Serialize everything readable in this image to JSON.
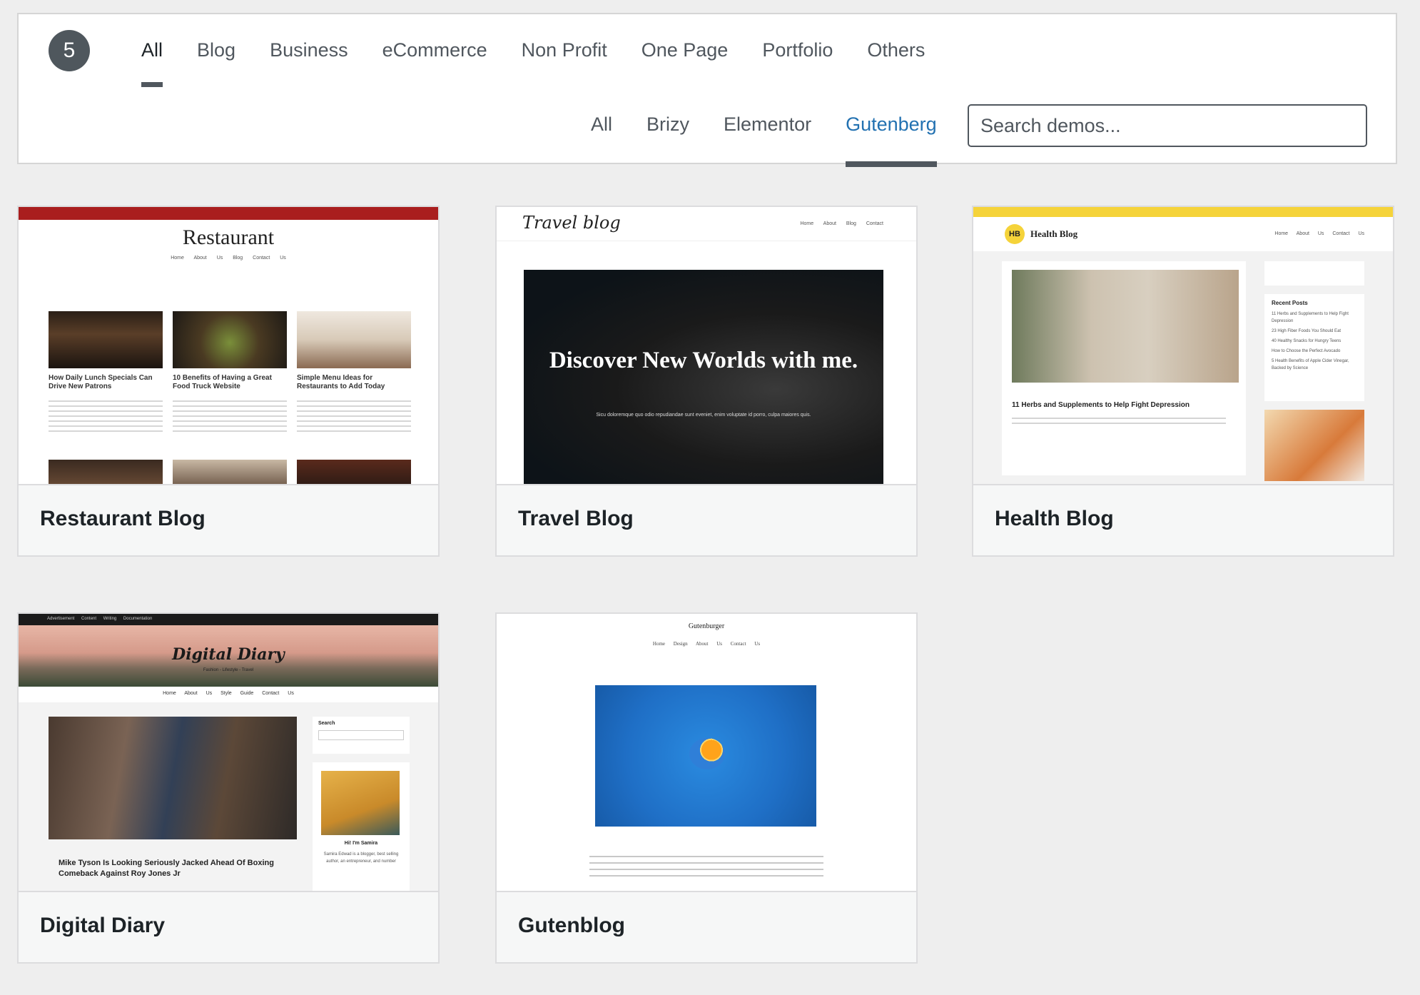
{
  "header": {
    "count": "5",
    "category_tabs": [
      {
        "label": "All",
        "active": true
      },
      {
        "label": "Blog",
        "active": false
      },
      {
        "label": "Business",
        "active": false
      },
      {
        "label": "eCommerce",
        "active": false
      },
      {
        "label": "Non Profit",
        "active": false
      },
      {
        "label": "One Page",
        "active": false
      },
      {
        "label": "Portfolio",
        "active": false
      },
      {
        "label": "Others",
        "active": false
      }
    ],
    "builder_tabs": [
      {
        "label": "All",
        "active": false
      },
      {
        "label": "Brizy",
        "active": false
      },
      {
        "label": "Elementor",
        "active": false
      },
      {
        "label": "Gutenberg",
        "active": true
      }
    ],
    "search_placeholder": "Search demos..."
  },
  "colors": {
    "active_builder_tab": "#2271b1",
    "badge": "#4f575d",
    "restaurant_accent": "#a91e1e",
    "health_accent": "#f5d33a"
  },
  "demos": [
    {
      "title": "Restaurant Blog",
      "thumb": {
        "logo": "Restaurant",
        "nav": "Home About Us Blog Contact Us",
        "posts": [
          "How Daily Lunch Specials Can Drive New Patrons",
          "10 Benefits of Having a Great Food Truck Website",
          "Simple Menu Ideas for Restaurants to Add Today"
        ]
      }
    },
    {
      "title": "Travel Blog",
      "thumb": {
        "logo": "Travel blog",
        "nav": "Home About Blog Contact",
        "hero_title": "Discover New Worlds with me.",
        "hero_sub": "Sicu doloremque quo odio repudiandae sunt eveniet, enim voluptate id porro, culpa maiores quis."
      }
    },
    {
      "title": "Health Blog",
      "thumb": {
        "badge": "HB",
        "logo": "Health Blog",
        "nav": "Home About Us Contact Us",
        "post_title": "11 Herbs and Supplements to Help Fight Depression",
        "sidebar_heading": "Recent Posts",
        "sidebar_items": [
          "11 Herbs and Supplements to Help Fight Depression",
          "23 High Fiber Foods You Should Eat",
          "40 Healthy Snacks for Hungry Teens",
          "How to Choose the Perfect Avocado",
          "5 Health Benefits of Apple Cider Vinegar, Backed by Science"
        ]
      }
    },
    {
      "title": "Digital Diary",
      "thumb": {
        "topbar": "Advertisement Content Writing Documentation",
        "logo": "Digital Diary",
        "tagline": "Fashion - Lifestyle - Travel",
        "nav": "Home About Us Style Guide Contact Us",
        "post_title": "Mike Tyson Is Looking Seriously Jacked Ahead Of Boxing Comeback Against Roy Jones Jr",
        "sidebar_search": "Search",
        "sidebar_name": "Hi! I'm Samira",
        "sidebar_bio": "Samira Edwad is a blogger, best selling author, an entrepreneur, and number"
      }
    },
    {
      "title": "Gutenblog",
      "thumb": {
        "brand": "Gutenburger",
        "nav": "Home Design About Us Contact Us"
      }
    }
  ]
}
